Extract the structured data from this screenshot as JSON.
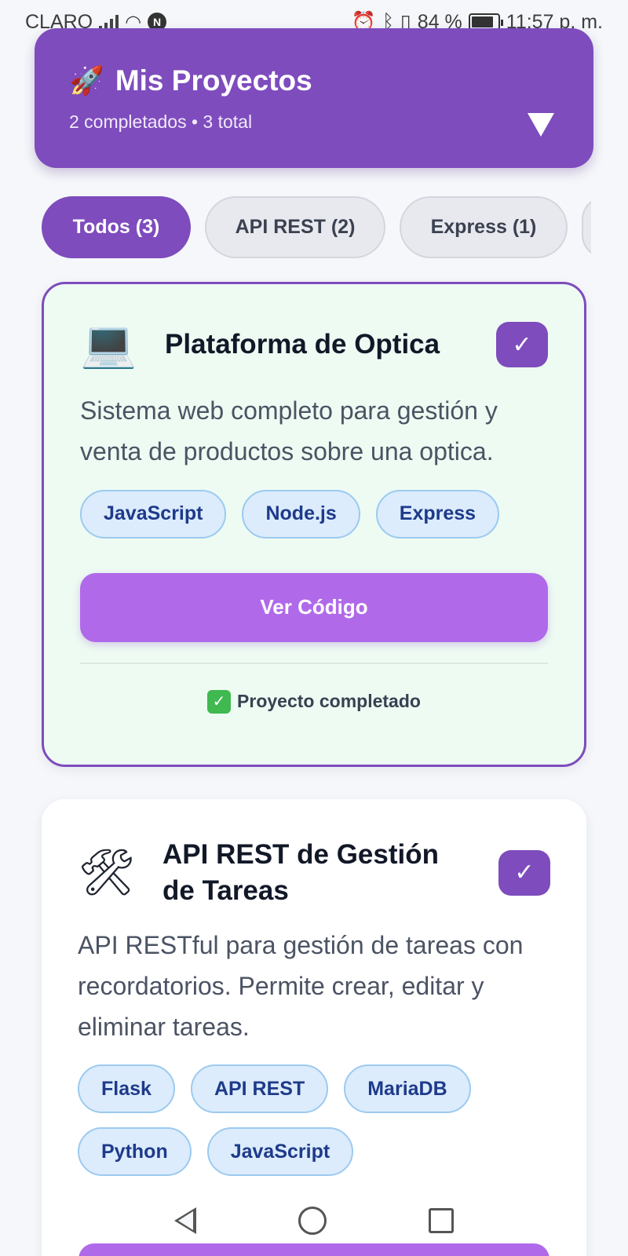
{
  "status_bar": {
    "carrier": "CLARO",
    "battery_text": "84 %",
    "battery_level": 0.84,
    "time": "11:57 p. m.",
    "icons": [
      "signal-icon",
      "wifi-icon",
      "nfc-icon",
      "alarm-icon",
      "bluetooth-icon",
      "vibrate-icon",
      "battery-icon"
    ]
  },
  "header": {
    "icon": "rocket-icon",
    "title": "Mis Proyectos",
    "subtitle": "2 completados • 3 total"
  },
  "tabs": [
    {
      "label": "Todos (3)",
      "active": true
    },
    {
      "label": "API REST (2)",
      "active": false
    },
    {
      "label": "Express (1)",
      "active": false
    },
    {
      "label": "",
      "active": false
    }
  ],
  "projects": [
    {
      "icon": "laptop-icon",
      "title": "Plataforma de Optica",
      "completed": true,
      "check": "✓",
      "description": "Sistema web completo para gestión y venta de productos sobre una optica.",
      "tags": [
        "JavaScript",
        "Node.js",
        "Express"
      ],
      "button_label": "Ver Código",
      "status_text": "Proyecto completado"
    },
    {
      "icon": "tools-icon",
      "title": "API REST de Gestión de Tareas",
      "completed": true,
      "check": "✓",
      "description": "API RESTful para gestión de tareas con recordatorios. Permite crear, editar y eliminar tareas.",
      "tags": [
        "Flask",
        "API REST",
        "MariaDB",
        "Python",
        "JavaScript"
      ]
    }
  ],
  "colors": {
    "accent": "#7e4cbd",
    "button": "#b06ae9",
    "tag_bg": "#dcecfd",
    "completed_card_bg": "#eefbf3"
  }
}
